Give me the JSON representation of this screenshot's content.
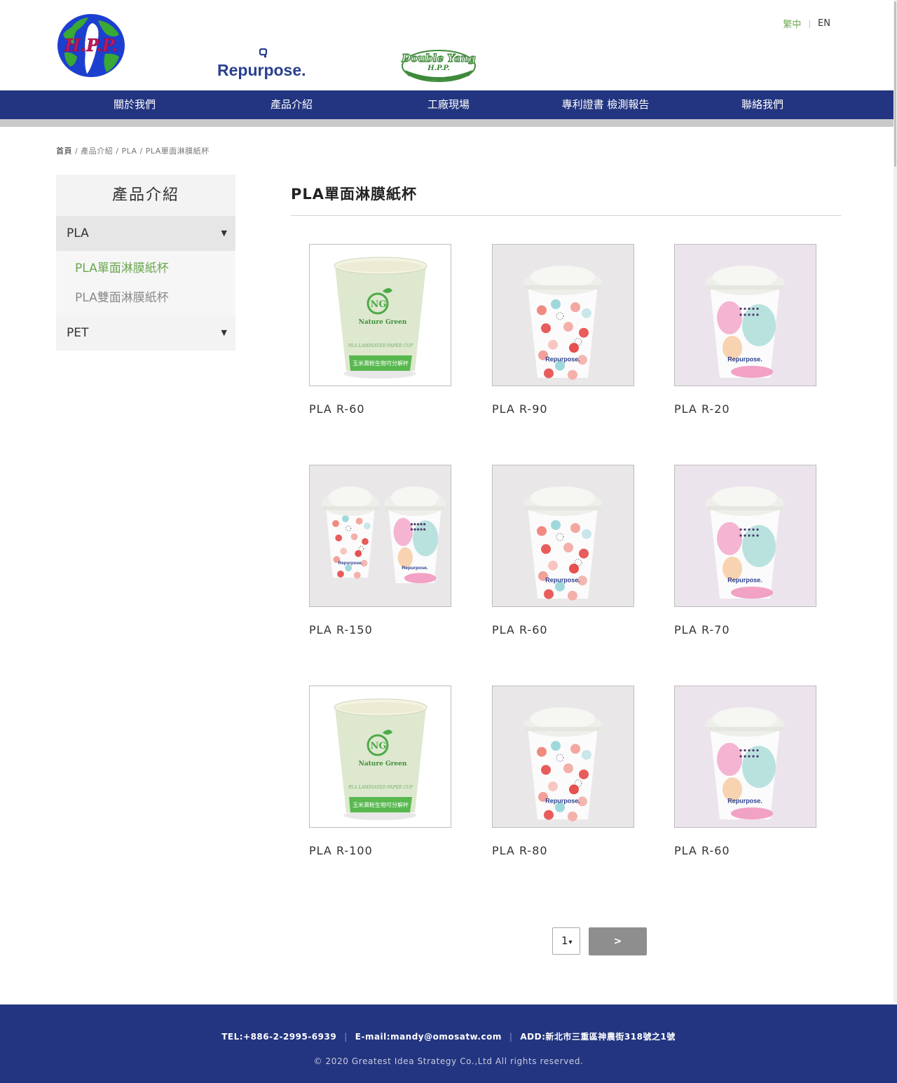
{
  "header": {
    "logos": {
      "hpp": "H.P.P.",
      "repurpose": "Repurpose.",
      "double_yang": "Double Yang",
      "double_yang_sub": "H.P.P."
    },
    "lang": {
      "zh": "繁中",
      "en": "EN"
    }
  },
  "nav": {
    "items": [
      "關於我們",
      "產品介紹",
      "工廠現場",
      "專利證書 檢測報告",
      "聯絡我們"
    ],
    "color": "#233580"
  },
  "breadcrumb": [
    "首頁",
    "產品介紹",
    "PLA",
    "PLA單面淋膜紙杯"
  ],
  "sidebar": {
    "title": "產品介紹",
    "categories": [
      {
        "label": "PLA",
        "arrow": "▼",
        "items": [
          "PLA單面淋膜紙杯",
          "PLA雙面淋膜紙杯"
        ]
      },
      {
        "label": "PET",
        "arrow": "▼"
      }
    ]
  },
  "main": {
    "title": "PLA單面淋膜紙杯",
    "products": [
      {
        "name": "PLA R-60",
        "image": "nature-green-cup"
      },
      {
        "name": "PLA R-90",
        "image": "repurpose-dots-cup"
      },
      {
        "name": "PLA R-20",
        "image": "repurpose-watercolor-cup"
      },
      {
        "name": "PLA R-150",
        "image": "repurpose-pair-cup"
      },
      {
        "name": "PLA R-60",
        "image": "repurpose-dots-cup"
      },
      {
        "name": "PLA R-70",
        "image": "repurpose-watercolor-cup"
      },
      {
        "name": "PLA R-100",
        "image": "nature-green-cup"
      },
      {
        "name": "PLA R-80",
        "image": "repurpose-dots-cup"
      },
      {
        "name": "PLA R-60",
        "image": "repurpose-watercolor-cup"
      }
    ],
    "cup_print": {
      "brand_green": "Nature Green",
      "band_text": "PLA LAMINATED PAPER CUP",
      "band_text_zh": "玉米澱粉生物可分解杯",
      "brand_blue": "Repurpose."
    }
  },
  "pagination": {
    "page": "1",
    "caret": "▾",
    "next": ">"
  },
  "footer": {
    "tel": "TEL:+886-2-2995-6939",
    "email": "E-mail:mandy@omosatw.com",
    "address": "ADD:新北市三重區神農街318號之1號",
    "copyright": "© 2020 Greatest Idea Strategy Co.,Ltd All rights reserved."
  },
  "colors": {
    "navy": "#233580",
    "green": "#6aa84f",
    "gray_button": "#8e8e8e"
  }
}
